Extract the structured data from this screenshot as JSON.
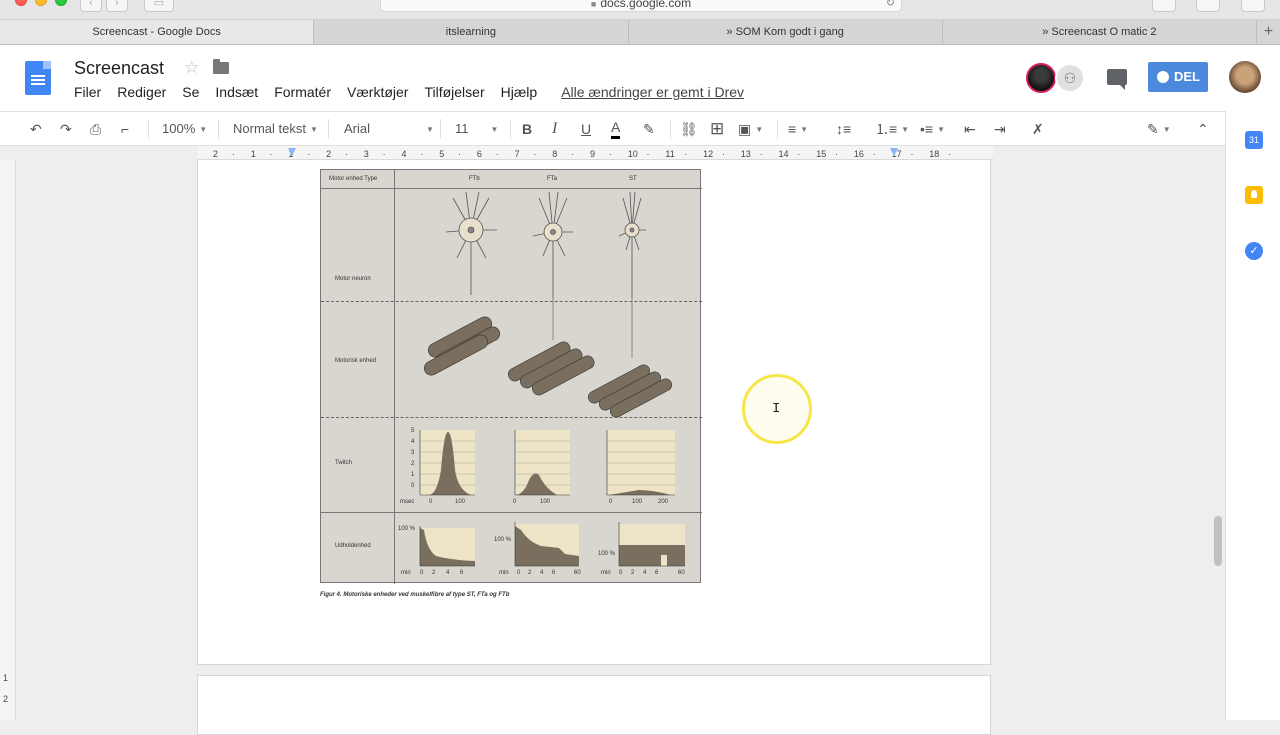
{
  "browser": {
    "url": "docs.google.com",
    "tabs": [
      "Screencast - Google Docs",
      "itslearning",
      "» SOM Kom godt i gang",
      "» Screencast O matic 2"
    ],
    "new_tab_label": "+"
  },
  "doc": {
    "title": "Screencast",
    "menu": [
      "Filer",
      "Rediger",
      "Se",
      "Indsæt",
      "Formatér",
      "Værktøjer",
      "Tilføjelser",
      "Hjælp"
    ],
    "save_status": "Alle ændringer er gemt i Drev",
    "share_label": "DEL"
  },
  "toolbar": {
    "zoom": "100%",
    "style": "Normal tekst",
    "font": "Arial",
    "size": "11",
    "bold": "B",
    "italic": "I",
    "underline": "U",
    "text_color": "A"
  },
  "side_panel": {
    "calendar_day": "31"
  },
  "ruler": {
    "labels": [
      "2",
      "1",
      "1",
      "2",
      "3",
      "4",
      "5",
      "6",
      "7",
      "8",
      "9",
      "10",
      "11",
      "12",
      "13",
      "14",
      "15",
      "16",
      "17",
      "18"
    ]
  },
  "vertical_ruler": {
    "labels": [
      "1",
      "2"
    ]
  },
  "figure": {
    "header_first": "Motor enhed Type",
    "columns": [
      "FTb",
      "FTa",
      "ST"
    ],
    "rows": [
      "Motor neuron",
      "Motorisk enhed",
      "Twitch",
      "Udholdenhed"
    ],
    "twitch_y_ticks": [
      "5",
      "4",
      "3",
      "2",
      "1",
      "0"
    ],
    "twitch_y_unit": "msec",
    "twitch_x_ticks": [
      [
        "0",
        "100"
      ],
      [
        "0",
        "100"
      ],
      [
        "0",
        "100",
        "200"
      ]
    ],
    "endurance_y_label": "100 %",
    "endurance_x_unit": "min",
    "endurance_x_ticks": [
      [
        "0",
        "2",
        "4",
        "6"
      ],
      [
        "0",
        "2",
        "4",
        "6",
        "60"
      ],
      [
        "0",
        "2",
        "4",
        "6",
        "60"
      ]
    ],
    "caption": "Figur 4. Motoriske enheder ved muskelfibre af type ST, FTa og FTb"
  },
  "colors": {
    "share_button": "#4a89dc",
    "docs_blue": "#4285f4",
    "cursor_ring": "#f7e64b"
  }
}
